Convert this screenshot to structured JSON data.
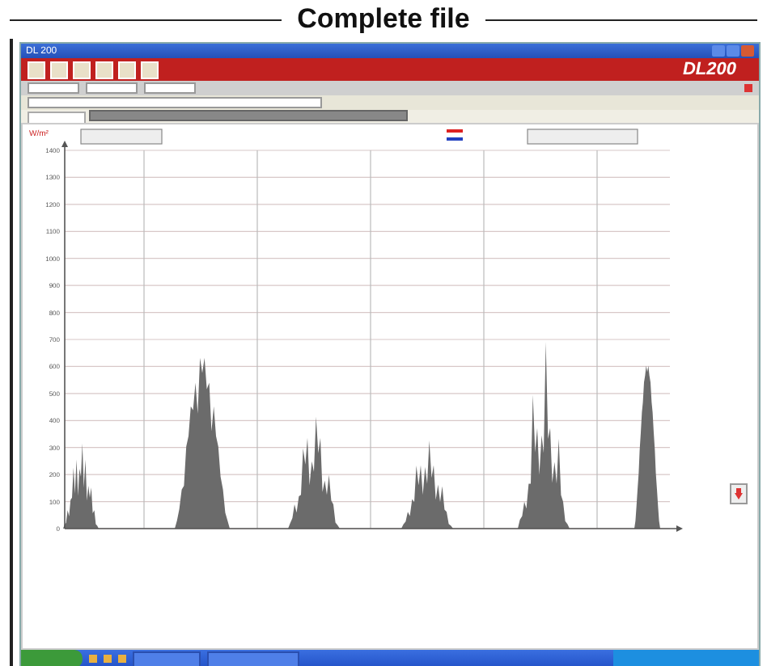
{
  "heading": "Complete file",
  "window": {
    "title": "DL 200",
    "logo": "DL200"
  },
  "chart": {
    "unit": "W/m²",
    "yticks": [
      "1400",
      "1300",
      "1200",
      "1100",
      "1000",
      "900",
      "800",
      "700",
      "600",
      "500",
      "400",
      "300",
      "200",
      "100",
      "0"
    ]
  }
}
